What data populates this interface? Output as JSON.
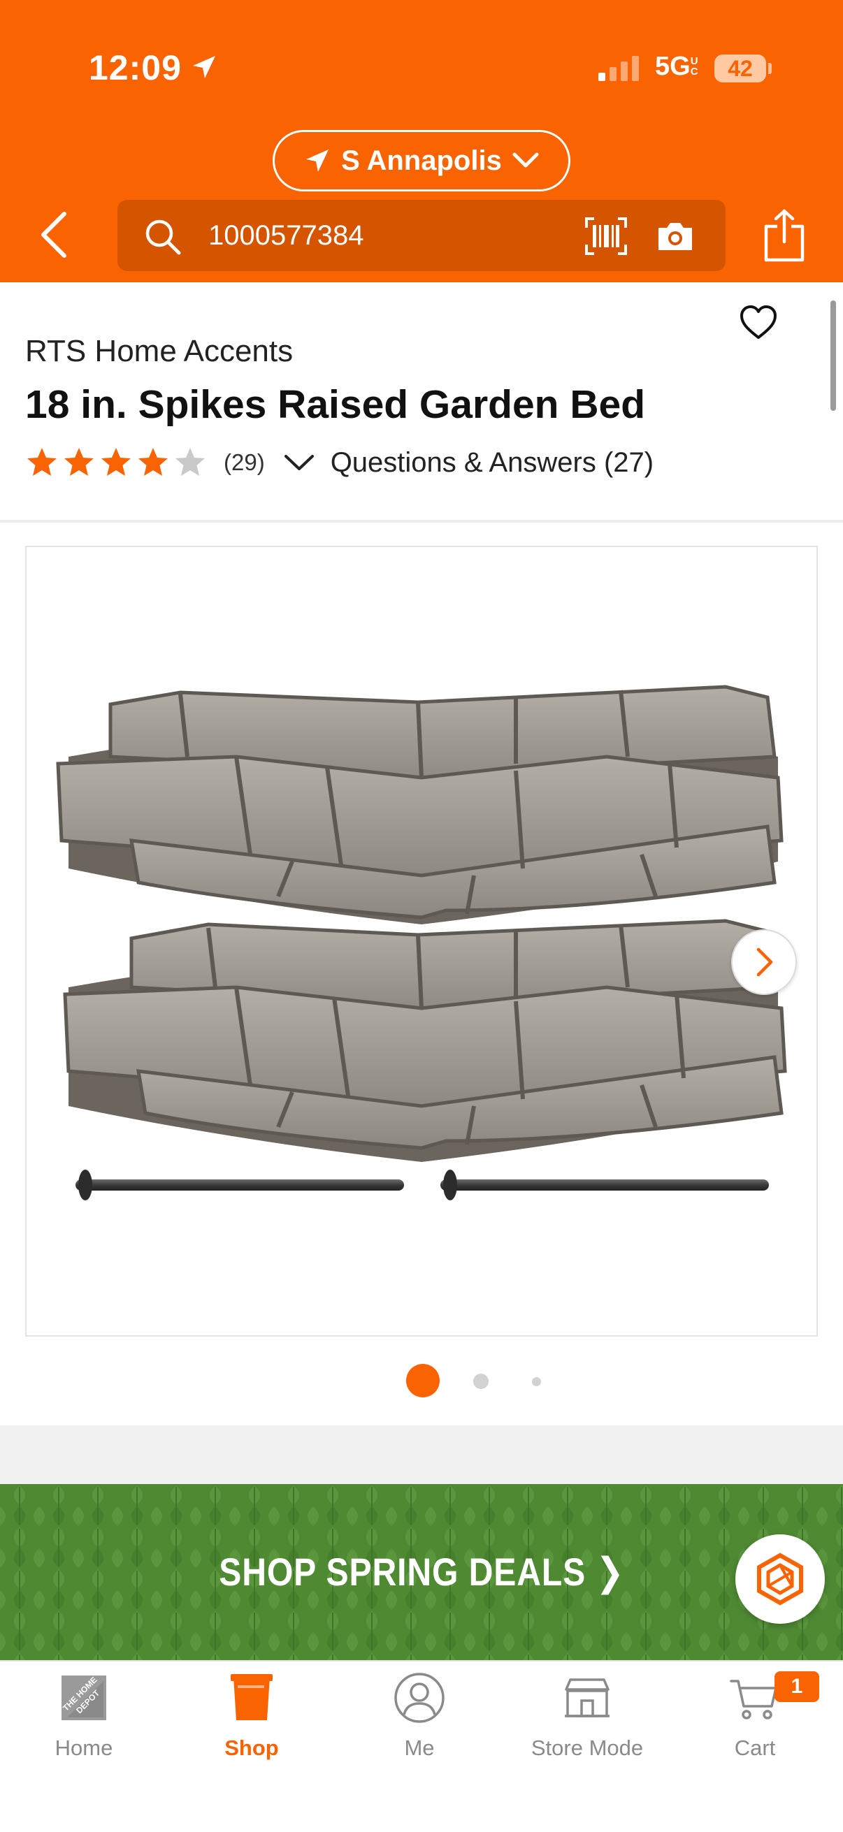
{
  "status_bar": {
    "time": "12:09",
    "network": "5G",
    "network_superscript": "UC",
    "battery": "42"
  },
  "header": {
    "store_name": "S Annapolis",
    "search_value": "1000577384",
    "accent_color": "#F96302"
  },
  "product": {
    "brand": "RTS Home Accents",
    "title": "18 in. Spikes Raised Garden Bed",
    "rating": 4,
    "rating_max": 5,
    "review_count": "(29)",
    "qa_label": "Questions & Answers (27)"
  },
  "gallery": {
    "image_count": 3,
    "active_index": 0
  },
  "promo": {
    "text": "SHOP SPRING DEALS ❯",
    "color": "#4F8A33"
  },
  "bottom_nav": {
    "items": [
      {
        "label": "Home",
        "icon": "home-depot-logo-icon"
      },
      {
        "label": "Shop",
        "icon": "shop-bucket-icon"
      },
      {
        "label": "Me",
        "icon": "user-icon"
      },
      {
        "label": "Store Mode",
        "icon": "store-icon"
      },
      {
        "label": "Cart",
        "icon": "cart-icon"
      }
    ],
    "active": "Shop",
    "cart_count": "1"
  }
}
